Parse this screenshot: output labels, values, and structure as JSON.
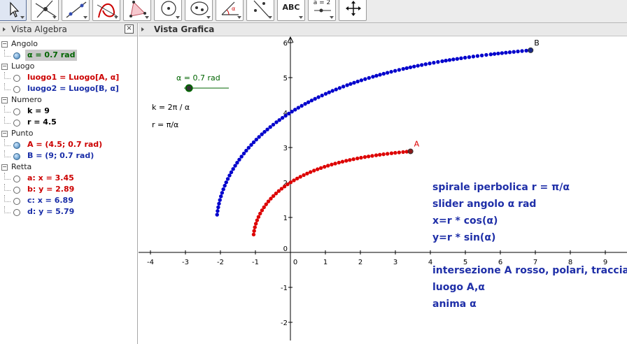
{
  "toolbar": {
    "text_tools": [
      {
        "name": "text-tool",
        "label": "ABC"
      },
      {
        "name": "slider-tool",
        "label": "a = 2"
      }
    ]
  },
  "algebra": {
    "title": "Vista Algebra",
    "close_label": "×",
    "categories": [
      {
        "label": "Angolo",
        "items": [
          {
            "text": "α = 0.7 rad",
            "color": "#006400",
            "filled": true,
            "highlight": true
          }
        ]
      },
      {
        "label": "Luogo",
        "items": [
          {
            "text": "luogo1 = Luogo[A, α]",
            "color": "#cc0000",
            "filled": false
          },
          {
            "text": "luogo2 = Luogo[B, α]",
            "color": "#1a2ea8",
            "filled": false
          }
        ]
      },
      {
        "label": "Numero",
        "items": [
          {
            "text": "k = 9",
            "color": "#000000",
            "filled": false
          },
          {
            "text": "r = 4.5",
            "color": "#000000",
            "filled": false
          }
        ]
      },
      {
        "label": "Punto",
        "items": [
          {
            "text": "A = (4.5; 0.7 rad)",
            "color": "#cc0000",
            "filled": true
          },
          {
            "text": "B = (9; 0.7 rad)",
            "color": "#1a2ea8",
            "filled": true
          }
        ]
      },
      {
        "label": "Retta",
        "items": [
          {
            "text": "a: x = 3.45",
            "color": "#cc0000",
            "filled": false
          },
          {
            "text": "b: y = 2.89",
            "color": "#cc0000",
            "filled": false
          },
          {
            "text": "c: x = 6.89",
            "color": "#1a2ea8",
            "filled": false
          },
          {
            "text": "d: y = 5.79",
            "color": "#1a2ea8",
            "filled": false
          }
        ]
      }
    ]
  },
  "graphics": {
    "title": "Vista Grafica",
    "x_ticks": [
      "-4",
      "-3",
      "-2",
      "-1",
      "0",
      "1",
      "2",
      "3",
      "4",
      "5",
      "6",
      "7",
      "8",
      "9"
    ],
    "y_ticks": [
      "-2",
      "-1",
      "0",
      "1",
      "2",
      "3",
      "4",
      "5",
      "6"
    ],
    "slider": {
      "label": "α = 0.7 rad",
      "value": 0.7
    },
    "formulas": [
      "k = 2π / α",
      "r = π/α"
    ],
    "point_a_label": "A",
    "point_b_label": "B",
    "notes1": [
      "spirale iperbolica r = π/α",
      "slider angolo α rad",
      "x=r * cos(α)",
      "y=r * sin(α)"
    ],
    "notes2": [
      "intersezione A rosso, polari, traccia",
      "luogo A,α",
      "anima α"
    ],
    "colors": {
      "red": "#dd0000",
      "blue": "#0000cc",
      "note": "#1f2fa8",
      "slider": "#006400"
    }
  }
}
